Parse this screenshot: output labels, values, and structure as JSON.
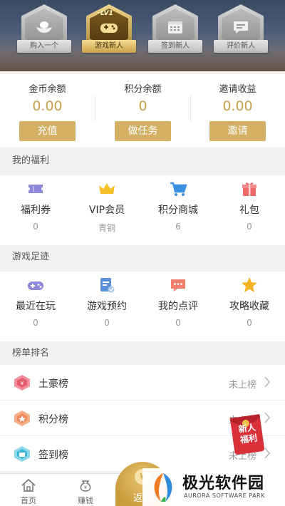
{
  "badges": [
    {
      "label": "购入一个",
      "icon": "ingot-icon",
      "active": false
    },
    {
      "label": "游戏新人",
      "icon": "gamepad-icon",
      "active": true,
      "level": "LV1"
    },
    {
      "label": "签到新人",
      "icon": "calendar-icon",
      "active": false
    },
    {
      "label": "评价新人",
      "icon": "comment-icon",
      "active": false
    }
  ],
  "balance": {
    "coins": {
      "label": "金币余额",
      "value": "0.00",
      "button": "充值"
    },
    "points": {
      "label": "积分余额",
      "value": "0",
      "button": "做任务"
    },
    "invite": {
      "label": "邀请收益",
      "value": "0.00",
      "button": "邀请"
    }
  },
  "welfare": {
    "title": "我的福利",
    "items": [
      {
        "name": "福利券",
        "sub": "0",
        "icon": "ticket-icon"
      },
      {
        "name": "VIP会员",
        "sub": "青铜",
        "icon": "crown-icon"
      },
      {
        "name": "积分商城",
        "sub": "6",
        "icon": "cart-icon"
      },
      {
        "name": "礼包",
        "sub": "0",
        "icon": "gift-icon"
      }
    ]
  },
  "footprint": {
    "title": "游戏足迹",
    "items": [
      {
        "name": "最近在玩",
        "sub": "0",
        "icon": "gamepad-icon"
      },
      {
        "name": "游戏预约",
        "sub": "0",
        "icon": "calendar-check-icon"
      },
      {
        "name": "我的点评",
        "sub": "0",
        "icon": "comment-icon"
      },
      {
        "name": "攻略收藏",
        "sub": "0",
        "icon": "star-icon"
      }
    ]
  },
  "ranking": {
    "title": "榜单排名",
    "items": [
      {
        "name": "土豪榜",
        "status": "未上榜",
        "icon": "rich-medal-icon"
      },
      {
        "name": "积分榜",
        "status": "未上榜",
        "icon": "points-medal-icon"
      },
      {
        "name": "签到榜",
        "status": "未上榜",
        "icon": "signin-medal-icon"
      }
    ]
  },
  "floating_gift": {
    "text_line1": "新人",
    "text_line2": "福利"
  },
  "tabbar": {
    "home": "首页",
    "earn": "赚钱",
    "rebate": "返利"
  },
  "watermark": {
    "cn": "极光软件园",
    "en": "AURORA SOFTWARE PARK"
  },
  "colors": {
    "gold": "#d4b064",
    "value_gold": "#c9a04e",
    "tab_gold": "#c99b3d"
  }
}
